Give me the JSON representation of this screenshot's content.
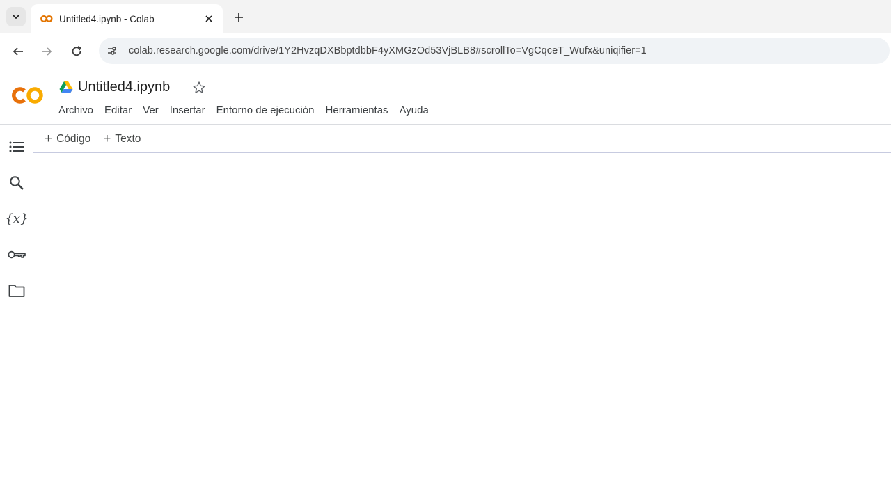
{
  "browser": {
    "tab_title": "Untitled4.ipynb - Colab",
    "url": "colab.research.google.com/drive/1Y2HvzqDXBbptdbbF4yXMGzOd53VjBLB8#scrollTo=VgCqceT_Wufx&uniqifier=1",
    "icons": {
      "tab_search": "chevron-down-icon",
      "favicon": "colab-favicon-icon",
      "close": "close-icon",
      "new_tab": "plus-icon",
      "back": "arrow-left-icon",
      "forward": "arrow-right-icon",
      "reload": "reload-icon",
      "site_info": "tune-icon"
    }
  },
  "colab": {
    "logo": "CO",
    "doc_title": "Untitled4.ipynb",
    "menu": [
      "Archivo",
      "Editar",
      "Ver",
      "Insertar",
      "Entorno de ejecución",
      "Herramientas",
      "Ayuda"
    ],
    "add_code_label": "Código",
    "add_text_label": "Texto",
    "sidebar_icons": [
      "list-icon",
      "search-icon",
      "variables-icon",
      "key-icon",
      "folder-icon"
    ],
    "variables_glyph": "{x}"
  },
  "colors": {
    "tabstrip_bg": "#f3f3f3",
    "omnibox_bg": "#f0f3f6",
    "colab_orange": "#f9ab00",
    "colab_orange_dark": "#e8710a"
  }
}
